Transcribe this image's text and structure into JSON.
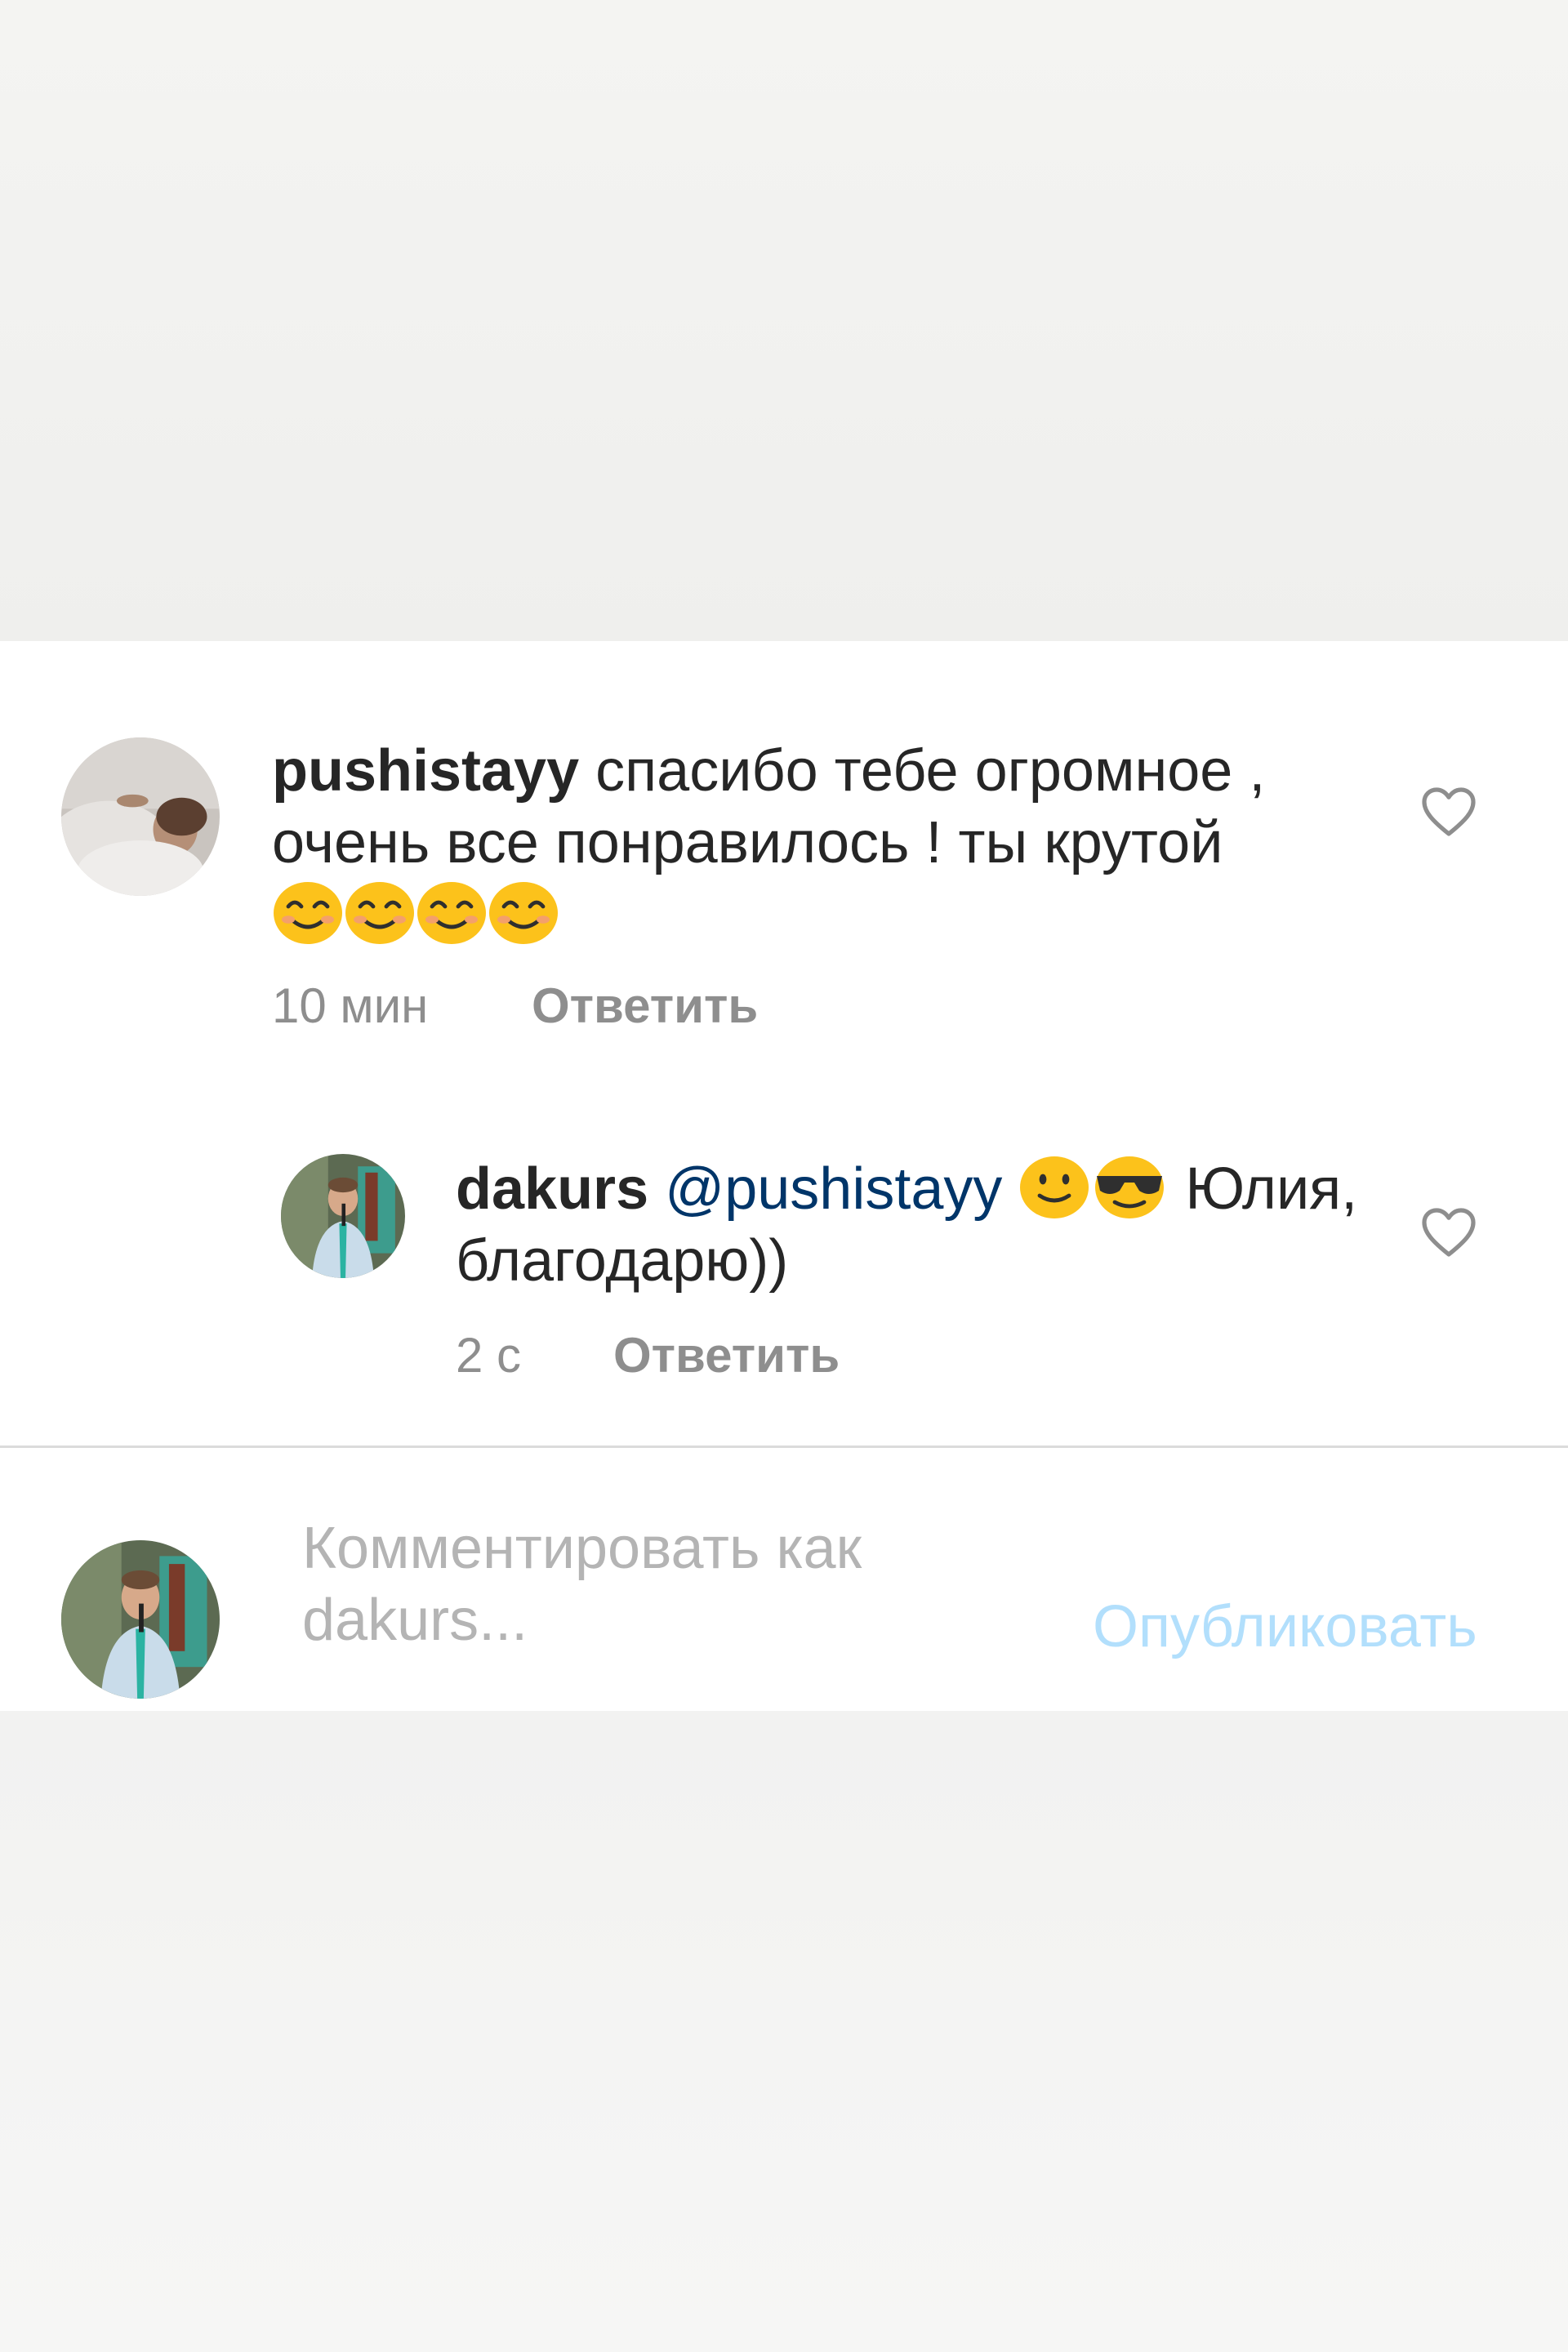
{
  "comments": [
    {
      "username": "pushistayy",
      "text_line1": "спасибо тебе огромное ,",
      "text_line2": "очень все понравилось ! ты крутой",
      "emojis": [
        "smiling-eyes-emoji",
        "smiling-eyes-emoji",
        "smiling-eyes-emoji",
        "smiling-eyes-emoji"
      ],
      "time": "10 мин",
      "reply_label": "Ответить"
    }
  ],
  "reply": {
    "username": "dakurs",
    "mention": "@pushistayy",
    "emojis": [
      "slightly-smiling-emoji",
      "sunglasses-emoji"
    ],
    "text_after": "Юлия,",
    "text_line2": "благодарю))",
    "time": "2 с",
    "reply_label": "Ответить"
  },
  "composer": {
    "placeholder_line1": "Комментировать как",
    "placeholder_line2": "dakurs...",
    "publish_label": "Опубликовать"
  },
  "colors": {
    "text": "#262626",
    "meta": "#8e8e8e",
    "mention": "#003569",
    "publish_disabled": "#b2dffc",
    "emoji_yellow": "#fcc21b"
  }
}
